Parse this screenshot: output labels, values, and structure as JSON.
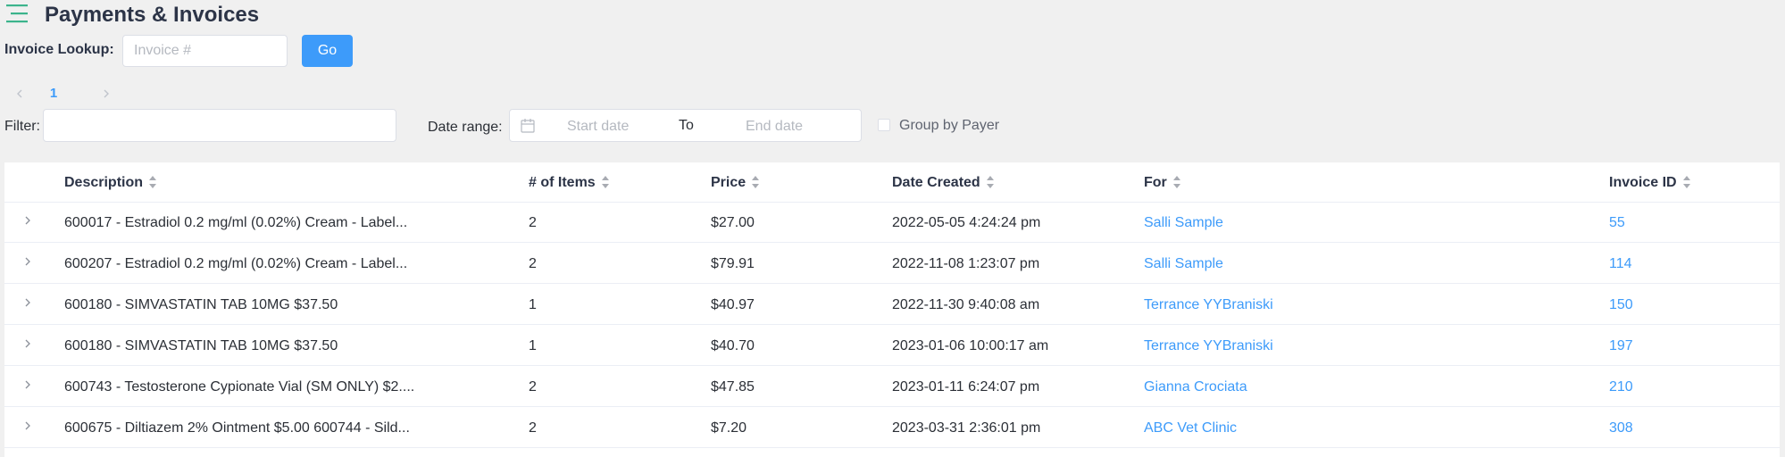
{
  "header": {
    "title": "Payments & Invoices"
  },
  "lookup": {
    "label": "Invoice Lookup:",
    "placeholder": "Invoice #",
    "go_label": "Go"
  },
  "pagination": {
    "current_page": "1"
  },
  "filters": {
    "filter_label": "Filter:",
    "date_range_label": "Date range:",
    "start_placeholder": "Start date",
    "to_label": "To",
    "end_placeholder": "End date",
    "group_label": "Group by Payer"
  },
  "table": {
    "columns": {
      "description": "Description",
      "items": "# of Items",
      "price": "Price",
      "date": "Date Created",
      "for": "For",
      "invoice_id": "Invoice ID"
    },
    "rows": [
      {
        "description": "600017 - Estradiol 0.2 mg/ml (0.02%) Cream - Label...",
        "items": "2",
        "price": "$27.00",
        "date": "2022-05-05 4:24:24 pm",
        "for": "Salli Sample",
        "invoice_id": "55"
      },
      {
        "description": "600207 - Estradiol 0.2 mg/ml (0.02%) Cream - Label...",
        "items": "2",
        "price": "$79.91",
        "date": "2022-11-08 1:23:07 pm",
        "for": "Salli Sample",
        "invoice_id": "114"
      },
      {
        "description": "600180 - SIMVASTATIN TAB 10MG $37.50",
        "items": "1",
        "price": "$40.97",
        "date": "2022-11-30 9:40:08 am",
        "for": "Terrance YYBraniski",
        "invoice_id": "150"
      },
      {
        "description": "600180 - SIMVASTATIN TAB 10MG $37.50",
        "items": "1",
        "price": "$40.70",
        "date": "2023-01-06 10:00:17 am",
        "for": "Terrance YYBraniski",
        "invoice_id": "197"
      },
      {
        "description": "600743 - Testosterone Cypionate Vial (SM ONLY) $2....",
        "items": "2",
        "price": "$47.85",
        "date": "2023-01-11 6:24:07 pm",
        "for": "Gianna Crociata",
        "invoice_id": "210"
      },
      {
        "description": "600675 - Diltiazem 2% Ointment $5.00 600744 - Sild...",
        "items": "2",
        "price": "$7.20",
        "date": "2023-03-31 2:36:01 pm",
        "for": "ABC Vet Clinic",
        "invoice_id": "308"
      }
    ]
  },
  "colors": {
    "accent": "#3d9bfa",
    "menu_icon": "#3cb48c",
    "title": "#2c3447",
    "background": "#f0f0f0"
  },
  "icons": {
    "menu": "hamburger-menu-icon",
    "calendar": "calendar-icon",
    "sort": "sort-icon",
    "expand": "chevron-right-icon"
  }
}
